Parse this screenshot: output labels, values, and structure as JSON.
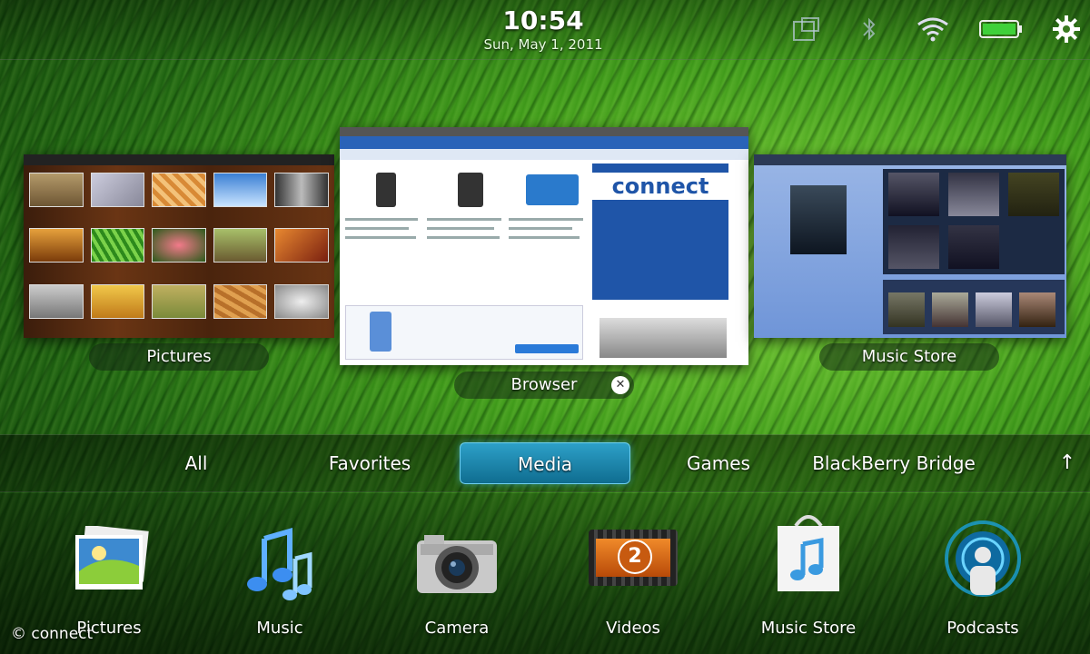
{
  "status": {
    "time": "10:54",
    "date": "Sun, May 1, 2011",
    "icons": [
      "orientation-icon",
      "bluetooth-icon",
      "wifi-icon",
      "battery-icon",
      "gear-icon"
    ]
  },
  "cards": [
    {
      "label": "Pictures",
      "icon": "pictures-card"
    },
    {
      "label": "Browser",
      "icon": "browser-card",
      "close": "✕",
      "site_logo": "connect"
    },
    {
      "label": "Music Store",
      "icon": "music-store-card"
    }
  ],
  "tabs": [
    {
      "label": "All"
    },
    {
      "label": "Favorites"
    },
    {
      "label": "Media",
      "active": true
    },
    {
      "label": "Games"
    },
    {
      "label": "BlackBerry Bridge"
    }
  ],
  "tab_arrow": "↑",
  "apps": [
    {
      "label": "Pictures",
      "icon": "pictures-icon"
    },
    {
      "label": "Music",
      "icon": "music-icon"
    },
    {
      "label": "Camera",
      "icon": "camera-icon"
    },
    {
      "label": "Videos",
      "icon": "videos-icon",
      "badge": "2"
    },
    {
      "label": "Music Store",
      "icon": "music-store-icon"
    },
    {
      "label": "Podcasts",
      "icon": "podcasts-icon"
    }
  ],
  "watermark": "© connect",
  "colors": {
    "accent": "#1a8fb8",
    "wallpaper": "#3f9a1a"
  }
}
